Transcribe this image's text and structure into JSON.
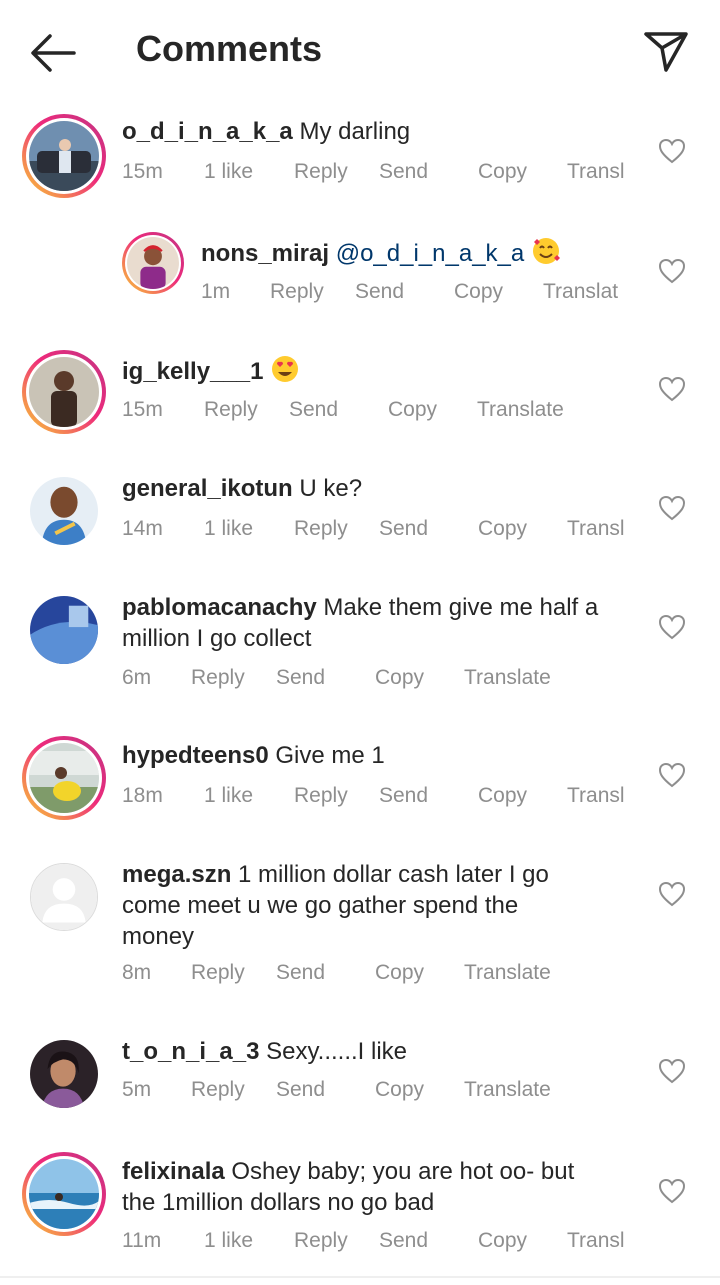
{
  "header": {
    "title": "Comments",
    "back_icon": "arrow-left-icon",
    "send_icon": "paper-plane-icon"
  },
  "colors": {
    "text": "#262626",
    "meta": "#8e8e8e",
    "mention": "#00376b",
    "ring_start": "#f9ce34",
    "ring_end": "#c13584"
  },
  "comments": [
    {
      "username": "o_d_i_n_a_k_a",
      "text": " My darling",
      "time": "15m",
      "likes": "1 like",
      "reply": "Reply",
      "send": "Send",
      "copy": "Copy",
      "translate": "Transl"
    },
    {
      "username": "nons_miraj",
      "mention": "@o_d_i_n_a_k_a",
      "text": " ",
      "time": "1m",
      "reply": "Reply",
      "send": "Send",
      "copy": "Copy",
      "translate": "Translat"
    },
    {
      "username": "ig_kelly___1",
      "text": " ",
      "time": "15m",
      "reply": "Reply",
      "send": "Send",
      "copy": "Copy",
      "translate": "Translate"
    },
    {
      "username": "general_ikotun",
      "text": " U ke?",
      "time": "14m",
      "likes": "1 like",
      "reply": "Reply",
      "send": "Send",
      "copy": "Copy",
      "translate": "Transl"
    },
    {
      "username": "pablomacanachy",
      "text": " Make them give me half a",
      "text2": "million I go collect",
      "time": "6m",
      "reply": "Reply",
      "send": "Send",
      "copy": "Copy",
      "translate": "Translate"
    },
    {
      "username": "hypedteens0",
      "text": " Give me 1",
      "time": "18m",
      "likes": "1 like",
      "reply": "Reply",
      "send": "Send",
      "copy": "Copy",
      "translate": "Transl"
    },
    {
      "username": "mega.szn",
      "text": " 1 million dollar cash later I go",
      "text2": "come meet u we go gather spend the",
      "text3": "money",
      "time": "8m",
      "reply": "Reply",
      "send": "Send",
      "copy": "Copy",
      "translate": "Translate"
    },
    {
      "username": "t_o_n_i_a_3",
      "text": " Sexy......I like",
      "time": "5m",
      "reply": "Reply",
      "send": "Send",
      "copy": "Copy",
      "translate": "Translate"
    },
    {
      "username": "felixinala",
      "text": " Oshey baby; you are hot oo- but",
      "text2": "the 1million dollars no go bad",
      "time": "11m",
      "likes": "1 like",
      "reply": "Reply",
      "send": "Send",
      "copy": "Copy",
      "translate": "Transl"
    }
  ]
}
